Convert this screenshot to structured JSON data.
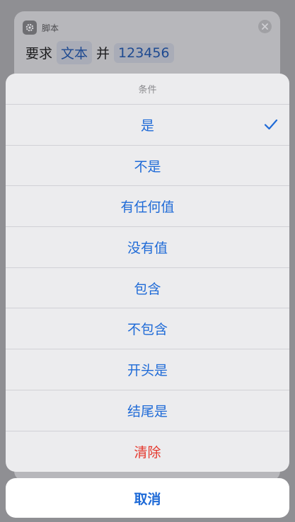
{
  "background": {
    "app_name": "脚本",
    "app_icon": "gear-icon",
    "close_icon": "close-icon",
    "row": {
      "prefix": "要求",
      "param1": "文本",
      "connector": "并",
      "param2": "123456"
    }
  },
  "sheet": {
    "title": "条件",
    "options": [
      {
        "label": "是",
        "selected": true
      },
      {
        "label": "不是"
      },
      {
        "label": "有任何值"
      },
      {
        "label": "没有值"
      },
      {
        "label": "包含"
      },
      {
        "label": "不包含"
      },
      {
        "label": "开头是"
      },
      {
        "label": "结尾是"
      },
      {
        "label": "清除",
        "destructive": true
      }
    ],
    "check_icon": "checkmark-icon"
  },
  "cancel_label": "取消",
  "colors": {
    "accent": "#1e6ad7",
    "destructive": "#e5382d"
  }
}
